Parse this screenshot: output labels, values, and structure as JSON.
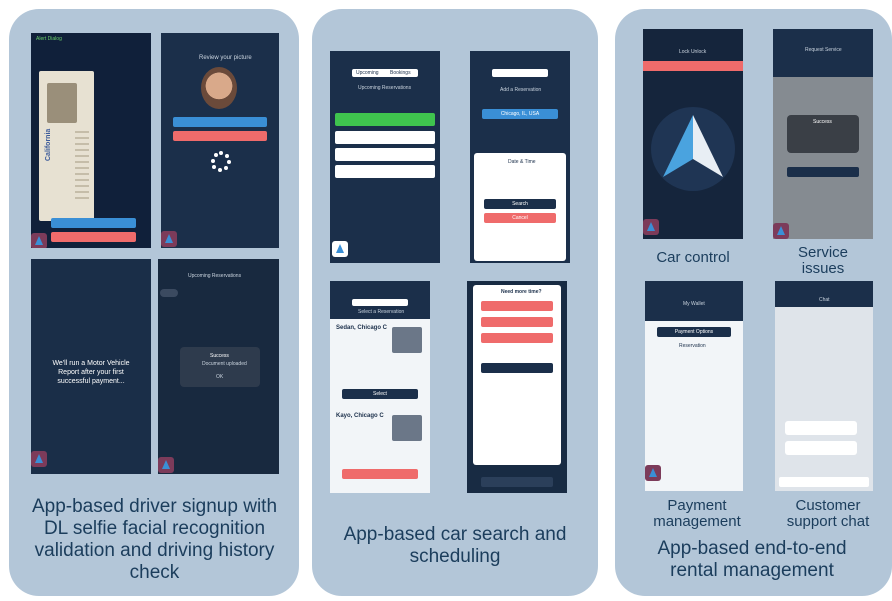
{
  "panels": [
    {
      "caption": "App-based driver signup with DL selfie facial recognition validation and driving history check"
    },
    {
      "caption": "App-based car search and scheduling"
    },
    {
      "caption": "App-based end-to-end rental management"
    }
  ],
  "screens": {
    "dl_scan": {
      "header": "Alert Dialog",
      "license_text": "California"
    },
    "selfie": {
      "title": "Review your picture"
    },
    "mvr": {
      "message": "We'll run a Motor Vehicle Report after your first successful payment..."
    },
    "success": {
      "header": "Upcoming Reservations",
      "modal_title": "Success",
      "modal_body": "Document uploaded",
      "modal_ok": "OK"
    },
    "reservations": {
      "tab1": "Upcoming",
      "tab2": "Bookings",
      "title": "Upcoming Reservations"
    },
    "add_reservation": {
      "title": "Add a Reservation",
      "location": "Chicago, IL, USA",
      "date_time": "Date & Time",
      "search": "Search",
      "cancel": "Cancel"
    },
    "select_reservation": {
      "title": "Select a Reservation",
      "car1": "Sedan, Chicago C",
      "car2": "Kayo, Chicago C",
      "select": "Select"
    },
    "need_more_time": {
      "title": "Need more time?"
    },
    "car_control": {
      "header": "Lock Unlock"
    },
    "service": {
      "header": "Request Service",
      "modal_title": "Success"
    },
    "payment": {
      "header": "My Wallet",
      "payment_options": "Payment Options",
      "reservation": "Reservation"
    },
    "chat": {
      "header": "Chat"
    }
  },
  "labels": {
    "car_control": "Car control",
    "service_issues": "Service issues",
    "payment_management": "Payment management",
    "customer_support": "Customer support chat"
  }
}
